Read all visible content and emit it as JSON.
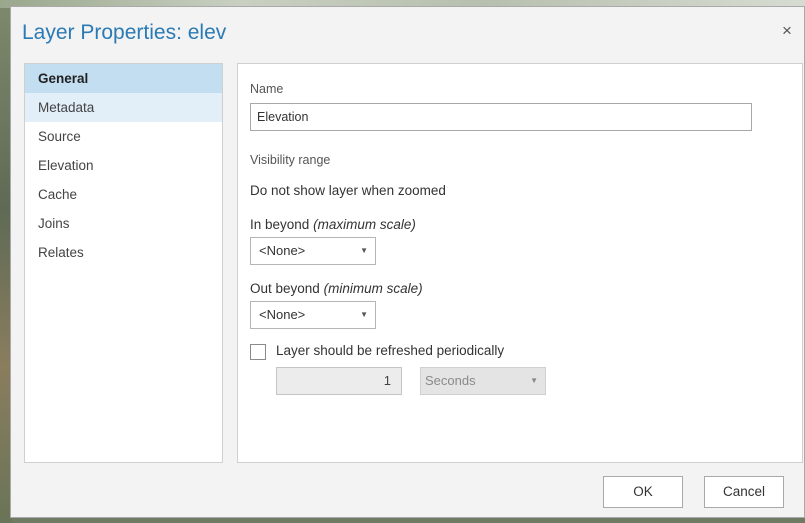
{
  "dialog": {
    "title": "Layer Properties: elev",
    "close_glyph": "×"
  },
  "nav": {
    "items": [
      {
        "label": "General",
        "state": "selected"
      },
      {
        "label": "Metadata",
        "state": "hover"
      },
      {
        "label": "Source",
        "state": ""
      },
      {
        "label": "Elevation",
        "state": ""
      },
      {
        "label": "Cache",
        "state": ""
      },
      {
        "label": "Joins",
        "state": ""
      },
      {
        "label": "Relates",
        "state": ""
      }
    ]
  },
  "general": {
    "name_label": "Name",
    "name_value": "Elevation",
    "visibility_heading": "Visibility range",
    "visibility_desc": "Do not show layer when zoomed",
    "in_beyond_label": "In beyond",
    "in_beyond_hint": "(maximum scale)",
    "in_beyond_value": "<None>",
    "out_beyond_label": "Out beyond",
    "out_beyond_hint": "(minimum scale)",
    "out_beyond_value": "<None>",
    "refresh_label": "Layer should be refreshed periodically",
    "refresh_checked": false,
    "refresh_interval": "1",
    "refresh_units": "Seconds"
  },
  "footer": {
    "ok_label": "OK",
    "cancel_label": "Cancel"
  },
  "colors": {
    "title": "#2a7ab5",
    "nav_selected": "#c3def1",
    "nav_hover": "#e2eef8"
  }
}
